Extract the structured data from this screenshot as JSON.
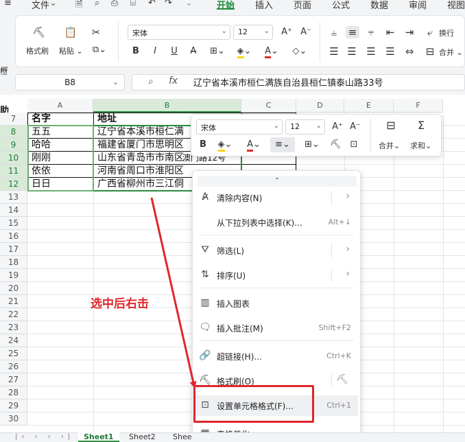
{
  "menu": {
    "file": "文件",
    "tabs": [
      "开始",
      "插入",
      "页面",
      "公式",
      "数据",
      "审阅",
      "视图"
    ],
    "active_tab": "开始"
  },
  "ribbon": {
    "format_painter": "格式刷",
    "paste": "粘贴",
    "font_name": "宋体",
    "font_size": "12",
    "wrap": "换行",
    "merge": "合并"
  },
  "formula_bar": {
    "name_box": "B8",
    "fx": "fx",
    "content": "辽宁省本溪市桓仁满族自治县桓仁镇泰山路33号"
  },
  "sheet": {
    "columns": [
      "A",
      "B",
      "C",
      "D",
      "E",
      "F"
    ],
    "rows": [
      "7",
      "8",
      "9",
      "10",
      "11",
      "12",
      "13",
      "14",
      "15",
      "16",
      "17",
      "18",
      "19",
      "20",
      "21",
      "22",
      "23",
      "24",
      "25",
      "26",
      "27",
      "28",
      "29",
      "30"
    ],
    "header_row": {
      "name": "名字",
      "address": "地址"
    },
    "data": [
      {
        "name": "五五",
        "address": "辽宁省本溪市桓仁满"
      },
      {
        "name": "哈哈",
        "address": "福建省厦门市思明区"
      },
      {
        "name": "刚刚",
        "address": "山东省青岛市市南区"
      },
      {
        "name": "依依",
        "address": "河南省周口市淮阳区"
      },
      {
        "name": "日日",
        "address": "广西省柳州市三江侗"
      }
    ],
    "partial_overflow": "澳门路12号"
  },
  "mini_toolbar": {
    "font_name": "宋体",
    "font_size": "12",
    "merge": "合并",
    "sum": "求和"
  },
  "context_menu": {
    "items": [
      {
        "label": "清除内容(N)",
        "shortcut": ""
      },
      {
        "label": "从下拉列表中选择(K)...",
        "shortcut": "Alt+↓"
      },
      {
        "label": "筛选(L)",
        "shortcut": ""
      },
      {
        "label": "排序(U)",
        "shortcut": ""
      },
      {
        "label": "插入图表",
        "shortcut": ""
      },
      {
        "label": "插入批注(M)",
        "shortcut": "Shift+F2"
      },
      {
        "label": "超链接(H)...",
        "shortcut": "Ctrl+K"
      },
      {
        "label": "格式刷(O)",
        "shortcut": ""
      },
      {
        "label": "设置单元格格式(F)...",
        "shortcut": "Ctrl+1"
      },
      {
        "label": "表格美化",
        "shortcut": ""
      }
    ]
  },
  "annotation": {
    "text": "选中后右击",
    "color": "#e0262b"
  },
  "sheet_tabs": [
    "Sheet1",
    "Sheet2",
    "Shee"
  ],
  "colors": {
    "accent": "#1f8a3a",
    "selection_border": "#2b8a3e"
  }
}
